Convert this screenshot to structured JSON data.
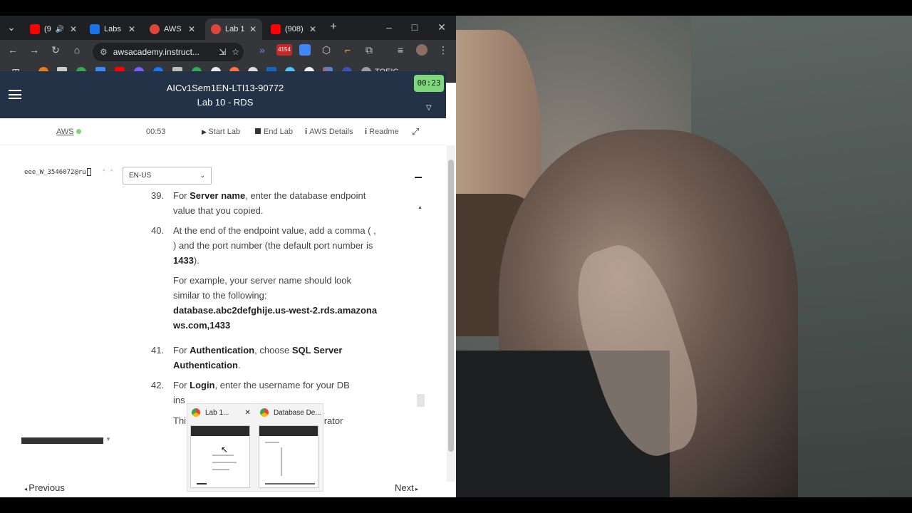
{
  "browser": {
    "tabs": [
      {
        "label": "(9",
        "favicon": "youtube-icon",
        "color": "#ff0000"
      },
      {
        "label": "Labs",
        "favicon": "labs-icon",
        "color": "#1a73e8"
      },
      {
        "label": "AWS",
        "favicon": "aws-icon",
        "color": "#e0453a"
      },
      {
        "label": "Lab 1",
        "favicon": "aws-icon",
        "color": "#e0453a"
      },
      {
        "label": "(908)",
        "favicon": "youtube-icon",
        "color": "#ff0000"
      }
    ],
    "url": "awsacademy.instruct...",
    "extension_badge": "4154",
    "bookmark_label": "TOEIC"
  },
  "lab": {
    "course_title": "AICv1Sem1EN-LTI13-90772",
    "lab_title": "Lab 10 - RDS",
    "session_timer": "00:23",
    "aws_label": "AWS",
    "time_left": "00:53",
    "start_lab": "Start Lab",
    "end_lab": "End Lab",
    "aws_details": "AWS Details",
    "readme": "Readme",
    "user_id": "eee_W_3546072@ru",
    "language": "EN-US",
    "steps": {
      "s39_num": "39.",
      "s39_a": "For ",
      "s39_b": "Server name",
      "s39_c": ", enter the database endpoint value that you copied.",
      "s40_num": "40.",
      "s40_a": "At the end of the endpoint value, add a comma ( , ) and the port number (the default port number is ",
      "s40_b": "1433",
      "s40_c": ").",
      "note1": "For example, your server name should look similar to the following:",
      "note2": "database.abc2defghije.us-west-2.rds.amazonaws.com,1433",
      "s41_num": "41.",
      "s41_a": "For ",
      "s41_b": "Authentication",
      "s41_c": ", choose ",
      "s41_d": "SQL Server Authentication",
      "s41_e": ".",
      "s42_num": "42.",
      "s42_a": "For ",
      "s42_b": "Login",
      "s42_c": ", enter the username for your DB",
      "s42_d": "ins",
      "s42_e": "Thi",
      "s42_f": "rator"
    },
    "previous": "Previous",
    "next": "Next"
  },
  "taskbar_preview": {
    "item1": "Lab 1...",
    "item2": "Database De..."
  }
}
